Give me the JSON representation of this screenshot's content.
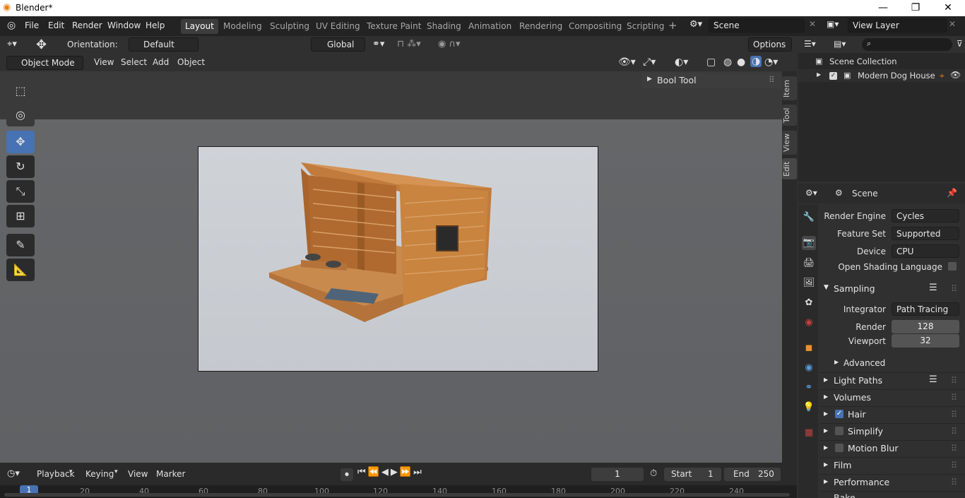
{
  "window": {
    "title": "Blender*",
    "minimize": "—",
    "maximize": "❐",
    "close": "✕"
  },
  "menu": [
    "File",
    "Edit",
    "Render",
    "Window",
    "Help"
  ],
  "workspaces": [
    "Layout",
    "Modeling",
    "Sculpting",
    "UV Editing",
    "Texture Paint",
    "Shading",
    "Animation",
    "Rendering",
    "Compositing",
    "Scripting"
  ],
  "scene_field": "Scene",
  "view_layer_field": "View Layer",
  "tool_header": {
    "orientation_label": "Orientation:",
    "orientation_value": "Default",
    "transform_orientation": "Global",
    "options": "Options"
  },
  "viewport_header": {
    "mode": "Object Mode",
    "menus": [
      "View",
      "Select",
      "Add",
      "Object"
    ]
  },
  "npanel": {
    "bool_tool": "Bool Tool",
    "tabs": [
      "Item",
      "Tool",
      "View",
      "Edit"
    ]
  },
  "outliner": {
    "root": "Scene Collection",
    "item": "Modern Dog House"
  },
  "properties": {
    "header": "Scene",
    "render_engine_label": "Render Engine",
    "render_engine": "Cycles",
    "feature_set_label": "Feature Set",
    "feature_set": "Supported",
    "device_label": "Device",
    "device": "CPU",
    "osl_label": "Open Shading Language",
    "sampling": "Sampling",
    "integrator_label": "Integrator",
    "integrator": "Path Tracing",
    "render_label": "Render",
    "render_samples": "128",
    "viewport_label": "Viewport",
    "viewport_samples": "32",
    "advanced": "Advanced",
    "panels": [
      "Light Paths",
      "Volumes",
      "Hair",
      "Simplify",
      "Motion Blur",
      "Film",
      "Performance",
      "Bake"
    ]
  },
  "timeline": {
    "menus": [
      "Playback",
      "Keying",
      "View",
      "Marker"
    ],
    "current_frame": "1",
    "start_label": "Start",
    "start": "1",
    "end_label": "End",
    "end": "250",
    "ruler": [
      "1",
      "20",
      "40",
      "60",
      "80",
      "100",
      "120",
      "140",
      "160",
      "180",
      "200",
      "220",
      "240"
    ]
  },
  "colors": {
    "accent": "#4772b3",
    "bg": "#303030",
    "header": "#232323"
  }
}
